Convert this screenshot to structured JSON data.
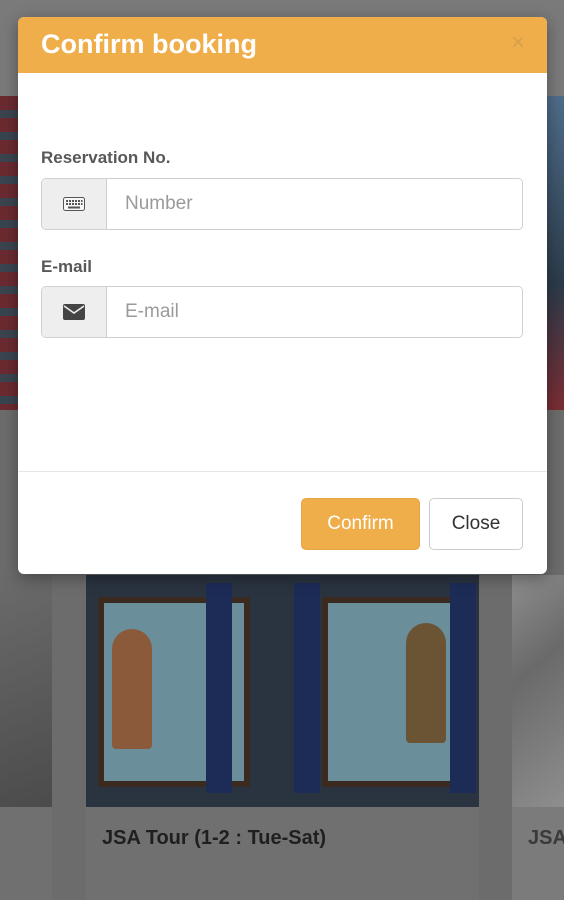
{
  "modal": {
    "title": "Confirm booking",
    "close_symbol": "×",
    "reservation": {
      "label": "Reservation No.",
      "placeholder": "Number",
      "value": "",
      "icon": "keyboard-icon"
    },
    "email": {
      "label": "E-mail",
      "placeholder": "E-mail",
      "value": "",
      "icon": "envelope-icon"
    },
    "buttons": {
      "confirm_label": "Confirm",
      "close_label": "Close"
    }
  },
  "background": {
    "cards": [
      {
        "title": "JSA Tour (1-2 : Tue-Sat)"
      },
      {
        "title": "JSA"
      }
    ]
  },
  "colors": {
    "accent": "#efae4a",
    "overlay": "#6f6f6f"
  }
}
